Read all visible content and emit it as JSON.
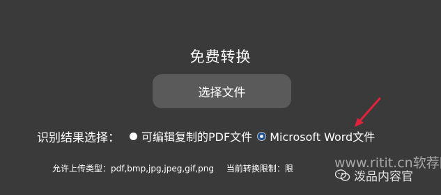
{
  "title": "免费转换",
  "select_button": "选择文件",
  "recognition": {
    "label": "识别结果选择：",
    "options": [
      {
        "text": "可编辑复制的PDF文件",
        "selected": false
      },
      {
        "text": "Microsoft Word文件",
        "selected": true
      }
    ]
  },
  "info": {
    "allowed_types": "允许上传类型：pdf,bmp,jpg,jpeg,gif,png",
    "current_limit": "当前转换限制：限"
  },
  "watermark": {
    "site": "www.ritit.cn软荐网",
    "wechat": "泼品内容官"
  },
  "colors": {
    "background": "#3a3a3a",
    "button": "#5a5a5a",
    "arrow": "#e0233a",
    "radio_selected": "#1d4f8f"
  },
  "icons": [
    "red-arrow-annotation-icon",
    "wechat-icon"
  ]
}
